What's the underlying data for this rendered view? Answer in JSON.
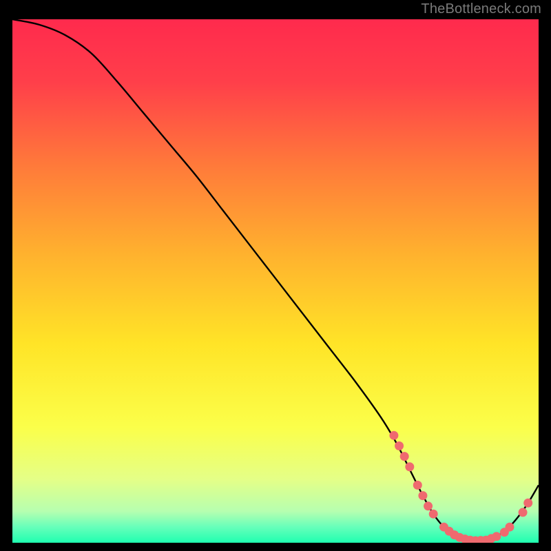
{
  "attribution": "TheBottleneck.com",
  "chart_data": {
    "type": "line",
    "title": "",
    "xlabel": "",
    "ylabel": "",
    "xlim": [
      0,
      100
    ],
    "ylim": [
      0,
      100
    ],
    "background": {
      "gradient_stops": [
        {
          "offset": 0.0,
          "color": "#ff2a4d"
        },
        {
          "offset": 0.12,
          "color": "#ff3f4a"
        },
        {
          "offset": 0.28,
          "color": "#ff7a3a"
        },
        {
          "offset": 0.45,
          "color": "#ffb22e"
        },
        {
          "offset": 0.62,
          "color": "#ffe427"
        },
        {
          "offset": 0.78,
          "color": "#fbff4a"
        },
        {
          "offset": 0.88,
          "color": "#e4ff88"
        },
        {
          "offset": 0.94,
          "color": "#b6ffb0"
        },
        {
          "offset": 0.97,
          "color": "#66ffba"
        },
        {
          "offset": 1.0,
          "color": "#1fffb0"
        }
      ]
    },
    "series": [
      {
        "name": "bottleneck-curve",
        "color": "#000000",
        "x": [
          0,
          5,
          10,
          15,
          20,
          25,
          30,
          35,
          40,
          45,
          50,
          55,
          60,
          65,
          70,
          73,
          76,
          78,
          80,
          82,
          84,
          86,
          88,
          90,
          92,
          94,
          96,
          98,
          100
        ],
        "values": [
          100,
          99,
          97,
          93.5,
          88,
          82,
          76,
          70,
          63.5,
          57,
          50.5,
          44,
          37.5,
          31,
          24,
          19,
          13,
          9,
          5.5,
          3,
          1.5,
          0.7,
          0.4,
          0.5,
          1.2,
          2.6,
          4.8,
          7.6,
          11
        ]
      }
    ],
    "markers": {
      "color": "#ef6a6f",
      "radius_px": 6.5,
      "points": [
        {
          "x": 72.5,
          "y": 20.5
        },
        {
          "x": 73.5,
          "y": 18.5
        },
        {
          "x": 74.5,
          "y": 16.5
        },
        {
          "x": 75.5,
          "y": 14.5
        },
        {
          "x": 77.0,
          "y": 11.0
        },
        {
          "x": 78.0,
          "y": 9.0
        },
        {
          "x": 79.0,
          "y": 7.0
        },
        {
          "x": 80.0,
          "y": 5.5
        },
        {
          "x": 82.0,
          "y": 3.0
        },
        {
          "x": 83.0,
          "y": 2.2
        },
        {
          "x": 84.0,
          "y": 1.5
        },
        {
          "x": 85.0,
          "y": 1.0
        },
        {
          "x": 86.0,
          "y": 0.7
        },
        {
          "x": 87.0,
          "y": 0.5
        },
        {
          "x": 88.0,
          "y": 0.4
        },
        {
          "x": 89.0,
          "y": 0.45
        },
        {
          "x": 90.0,
          "y": 0.5
        },
        {
          "x": 91.0,
          "y": 0.8
        },
        {
          "x": 92.0,
          "y": 1.2
        },
        {
          "x": 93.5,
          "y": 2.0
        },
        {
          "x": 94.5,
          "y": 3.0
        },
        {
          "x": 97.0,
          "y": 5.8
        },
        {
          "x": 98.0,
          "y": 7.6
        }
      ]
    }
  }
}
